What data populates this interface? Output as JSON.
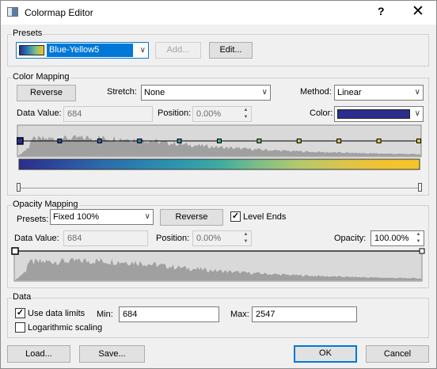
{
  "window": {
    "title": "Colormap Editor",
    "help_glyph": "?",
    "close_glyph": "✕"
  },
  "presets": {
    "group_label": "Presets",
    "selected": "Blue-Yellow5",
    "add_label": "Add...",
    "edit_label": "Edit..."
  },
  "color_mapping": {
    "group_label": "Color Mapping",
    "reverse_label": "Reverse",
    "stretch_label": "Stretch:",
    "stretch_value": "None",
    "method_label": "Method:",
    "method_value": "Linear",
    "data_value_label": "Data Value:",
    "data_value": "684",
    "position_label": "Position:",
    "position_value": "0.00%",
    "color_label": "Color:",
    "color_value": "#2c2d8c",
    "stops": [
      {
        "pos": 0.0,
        "color": "#2c2d8c"
      },
      {
        "pos": 0.1,
        "color": "#2c4a9e"
      },
      {
        "pos": 0.2,
        "color": "#2b68ab"
      },
      {
        "pos": 0.3,
        "color": "#2a80b0"
      },
      {
        "pos": 0.4,
        "color": "#2c97ad"
      },
      {
        "pos": 0.5,
        "color": "#3eaba0"
      },
      {
        "pos": 0.6,
        "color": "#7fbe87"
      },
      {
        "pos": 0.7,
        "color": "#b4c96c"
      },
      {
        "pos": 0.8,
        "color": "#d8c44e"
      },
      {
        "pos": 0.9,
        "color": "#f0c332"
      },
      {
        "pos": 1.0,
        "color": "#f6c427"
      }
    ]
  },
  "opacity_mapping": {
    "group_label": "Opacity Mapping",
    "presets_label": "Presets:",
    "presets_value": "Fixed 100%",
    "reverse_label": "Reverse",
    "level_ends_label": "Level Ends",
    "level_ends_checked": true,
    "data_value_label": "Data Value:",
    "data_value": "684",
    "position_label": "Position:",
    "position_value": "0.00%",
    "opacity_label": "Opacity:",
    "opacity_value": "100.00%"
  },
  "data": {
    "group_label": "Data",
    "use_data_limits_label": "Use data limits",
    "use_data_limits_checked": true,
    "min_label": "Min:",
    "min_value": "684",
    "max_label": "Max:",
    "max_value": "2547",
    "log_scaling_label": "Logarithmic scaling",
    "log_scaling_checked": false
  },
  "footer": {
    "load_label": "Load...",
    "save_label": "Save...",
    "ok_label": "OK",
    "cancel_label": "Cancel"
  },
  "colors": {
    "accent": "#0078d7",
    "histogram": "#a0a0a0",
    "panel": "#d9d9d9"
  }
}
